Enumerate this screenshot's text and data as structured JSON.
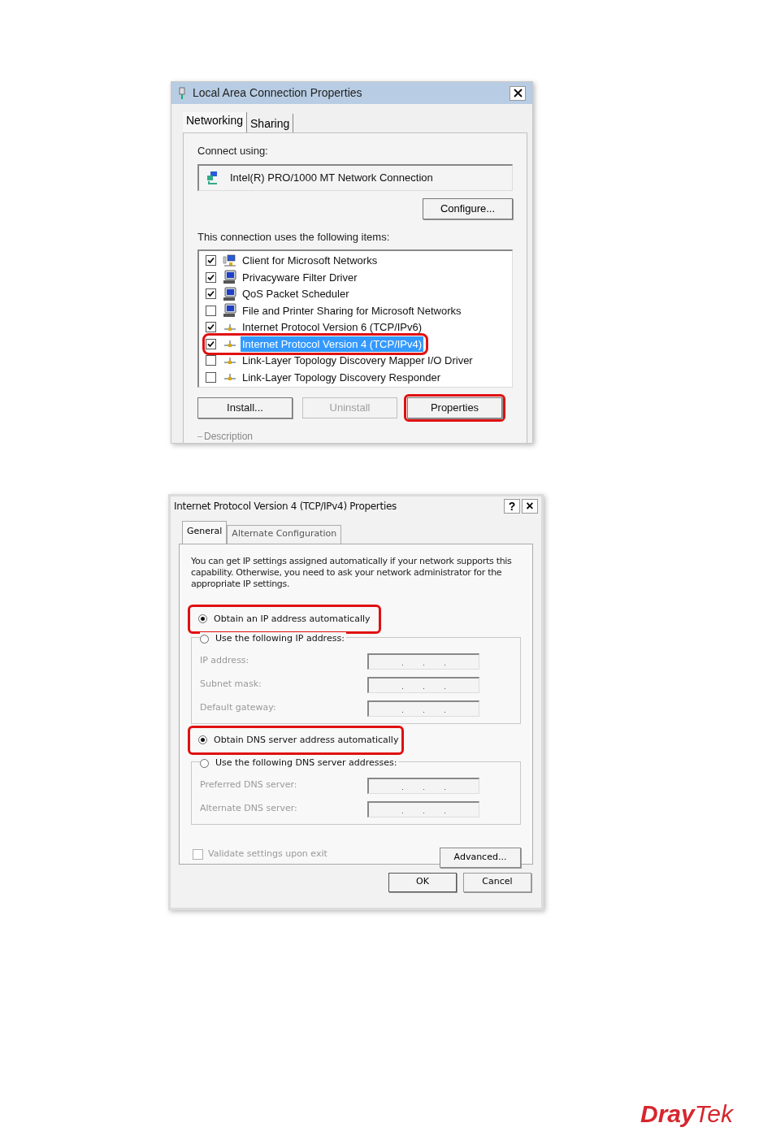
{
  "lan_dialog": {
    "title": "Local Area Connection Properties",
    "tabs": [
      {
        "label": "Networking",
        "selected": true
      },
      {
        "label": "Sharing",
        "selected": false
      }
    ],
    "connect_label": "Connect using:",
    "adapter": "Intel(R) PRO/1000 MT Network Connection",
    "configure": "Configure...",
    "items_label": "This connection uses the following items:",
    "items": [
      {
        "label": "Client for Microsoft Networks",
        "kind": "client",
        "checked": true,
        "selected": false,
        "highlighted": false
      },
      {
        "label": "Privacyware Filter Driver",
        "kind": "service",
        "checked": true,
        "selected": false,
        "highlighted": false
      },
      {
        "label": "QoS Packet Scheduler",
        "kind": "service",
        "checked": true,
        "selected": false,
        "highlighted": false
      },
      {
        "label": "File and Printer Sharing for Microsoft Networks",
        "kind": "service",
        "checked": false,
        "selected": false,
        "highlighted": false
      },
      {
        "label": "Internet Protocol Version 6 (TCP/IPv6)",
        "kind": "protocol",
        "checked": true,
        "selected": false,
        "highlighted": false
      },
      {
        "label": "Internet Protocol Version 4 (TCP/IPv4)",
        "kind": "protocol",
        "checked": true,
        "selected": true,
        "highlighted": true
      },
      {
        "label": "Link-Layer Topology Discovery Mapper I/O Driver",
        "kind": "protocol",
        "checked": false,
        "selected": false,
        "highlighted": false
      },
      {
        "label": "Link-Layer Topology Discovery Responder",
        "kind": "protocol",
        "checked": false,
        "selected": false,
        "highlighted": false
      }
    ],
    "buttons": [
      {
        "label": "Install...",
        "disabled": false,
        "highlighted": false
      },
      {
        "label": "Uninstall",
        "disabled": true,
        "highlighted": false
      },
      {
        "label": "Properties",
        "disabled": false,
        "highlighted": true
      }
    ],
    "description_label": "Description"
  },
  "ipv4_dialog": {
    "title": "Internet Protocol Version 4 (TCP/IPv4) Properties",
    "help": "?",
    "close": "×",
    "tabs": [
      {
        "label": "General",
        "selected": true
      },
      {
        "label": "Alternate Configuration",
        "selected": false
      }
    ],
    "intro": "You can get IP settings assigned automatically if your network supports this capability. Otherwise, you need to ask your network administrator for the appropriate IP settings.",
    "ip_auto": {
      "label": "Obtain an IP address automatically",
      "selected": true,
      "highlighted": true
    },
    "ip_manual": {
      "label": "Use the following IP address:",
      "selected": false
    },
    "ip_fields": [
      "IP address:",
      "Subnet mask:",
      "Default gateway:"
    ],
    "dns_auto": {
      "label": "Obtain DNS server address automatically",
      "selected": true,
      "highlighted": true
    },
    "dns_manual": {
      "label": "Use the following DNS server addresses:",
      "selected": false
    },
    "dns_fields": [
      "Preferred DNS server:",
      "Alternate DNS server:"
    ],
    "validate": {
      "label": "Validate settings upon exit",
      "checked": false,
      "disabled": true
    },
    "advanced": "Advanced...",
    "buttons": [
      "OK",
      "Cancel"
    ]
  },
  "logo": {
    "part_1": "Dray",
    "part_2": "Tek"
  }
}
